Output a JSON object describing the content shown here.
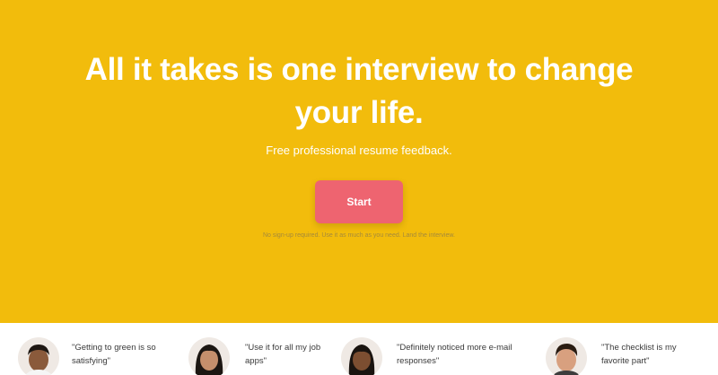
{
  "hero": {
    "headline": "All it takes is one interview to change your life.",
    "subhead": "Free professional resume feedback.",
    "start_label": "Start",
    "fineprint": "No sign-up required. Use it as much as you need. Land the interview."
  },
  "colors": {
    "hero_bg": "#f2bc0c",
    "button_bg": "#ee6470"
  },
  "testimonials": [
    {
      "quote": "\"Getting to green is so satisfying\""
    },
    {
      "quote": "\"Use it for all my job apps\""
    },
    {
      "quote": "\"Definitely noticed more e-mail responses\""
    },
    {
      "quote": "\"The checklist is my favorite part\""
    }
  ]
}
